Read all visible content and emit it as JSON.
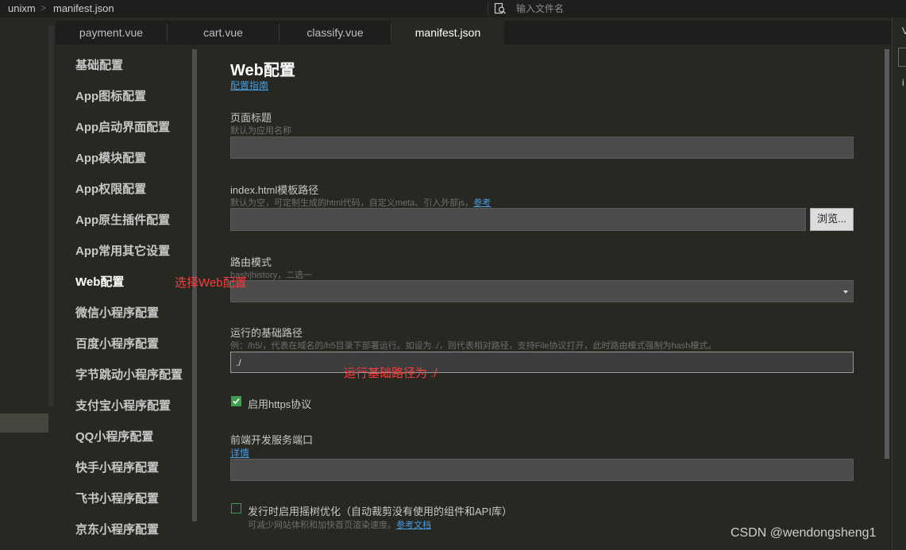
{
  "breadcrumb": {
    "project": "unixm",
    "separator": ">",
    "file": "manifest.json"
  },
  "file_search": {
    "placeholder": "输入文件名",
    "icon": "file-search-icon"
  },
  "tabs": [
    {
      "label": "payment.vue",
      "active": false
    },
    {
      "label": "cart.vue",
      "active": false
    },
    {
      "label": "classify.vue",
      "active": false
    },
    {
      "label": "manifest.json",
      "active": true
    }
  ],
  "nav": {
    "items": [
      {
        "label": "基础配置"
      },
      {
        "label": "App图标配置"
      },
      {
        "label": "App启动界面配置"
      },
      {
        "label": "App模块配置"
      },
      {
        "label": "App权限配置"
      },
      {
        "label": "App原生插件配置"
      },
      {
        "label": "App常用其它设置"
      },
      {
        "label": "Web配置",
        "active": true
      },
      {
        "label": "微信小程序配置"
      },
      {
        "label": "百度小程序配置"
      },
      {
        "label": "字节跳动小程序配置"
      },
      {
        "label": "支付宝小程序配置"
      },
      {
        "label": "QQ小程序配置"
      },
      {
        "label": "快手小程序配置"
      },
      {
        "label": "飞书小程序配置"
      },
      {
        "label": "京东小程序配置"
      }
    ]
  },
  "web": {
    "title": "Web配置",
    "guide_link": "配置指南",
    "page_title": {
      "label": "页面标题",
      "hint": "默认为应用名称",
      "value": ""
    },
    "template": {
      "label": "index.html模板路径",
      "hint": "默认为空，可定制生成的html代码，自定义meta、引入外部js，",
      "hint_link": "参考",
      "value": "",
      "browse": "浏览..."
    },
    "router": {
      "label": "路由模式",
      "hint": "hash|history，二选一",
      "value": ""
    },
    "base_path": {
      "label": "运行的基础路径",
      "hint": "例：/h5/，代表在域名的/h5目录下部署运行。如设为 ./，则代表相对路径，支持File协议打开，此时路由模式强制为hash模式。",
      "value": "./"
    },
    "https": {
      "label": "启用https协议",
      "checked": true
    },
    "dev_port": {
      "label": "前端开发服务端口",
      "link": "详情",
      "value": ""
    },
    "tree_shaking": {
      "label": "发行时启用摇树优化（自动裁剪没有使用的组件和API库）",
      "hint": "可减少网站体积和加快首页渲染速度。",
      "hint_link": "参考文档",
      "checked": false
    }
  },
  "annotations": {
    "select_web": "选择Web配置",
    "base_path_note": "运行基础路径为  ./"
  },
  "right_panel": {
    "char_top": "V",
    "char_mid": "i"
  },
  "watermark": "CSDN @wendongsheng1",
  "colors": {
    "accent_link": "#4a9de0",
    "annotation_red": "#ff3b3b",
    "checkbox_green": "#3d9f4e",
    "background": "#272822"
  }
}
